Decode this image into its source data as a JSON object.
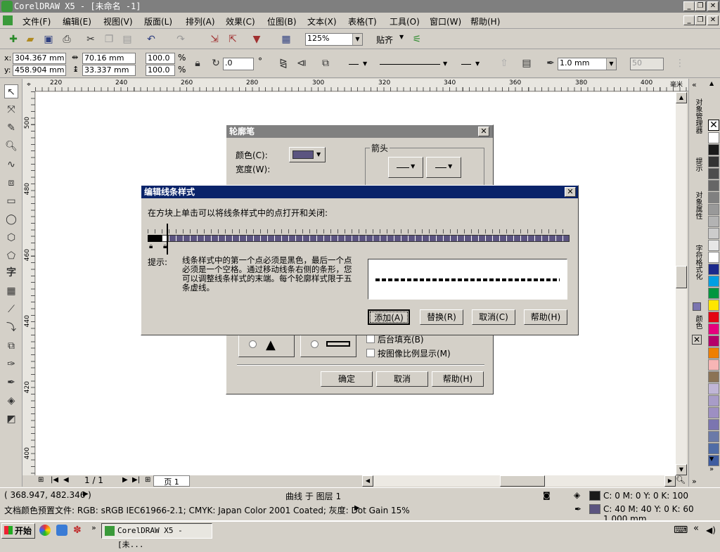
{
  "window": {
    "title": "CorelDRAW X5 - [未命名 -1]"
  },
  "menu": [
    "文件(F)",
    "编辑(E)",
    "视图(V)",
    "版面(L)",
    "排列(A)",
    "效果(C)",
    "位图(B)",
    "文本(X)",
    "表格(T)",
    "工具(O)",
    "窗口(W)",
    "帮助(H)"
  ],
  "toolbar": {
    "zoom": "125%",
    "snap_label": "贴齐"
  },
  "props": {
    "x": "304.367 mm",
    "y": "458.904 mm",
    "w": "70.16 mm",
    "h": "33.337 mm",
    "sx": "100.0",
    "sy": "100.0",
    "pct": "%",
    "angle": ".0",
    "deg": "°",
    "outline_width": "1.0 mm",
    "miter": "50"
  },
  "ruler": {
    "h_labels": [
      "220",
      "240",
      "260",
      "280",
      "300",
      "320",
      "340",
      "360",
      "380",
      "400"
    ],
    "unit": "毫米",
    "v_labels": [
      "500",
      "480",
      "460",
      "440",
      "420",
      "400"
    ]
  },
  "page_nav": {
    "count": "1 / 1",
    "tab": "页 1"
  },
  "dockers": [
    "对象管理器",
    "提示",
    "对象属性",
    "字符格式化",
    "颜色"
  ],
  "palette_colors": [
    "#ffffff",
    "#1a1a1a",
    "#333333",
    "#4d4d4d",
    "#666666",
    "#808080",
    "#999999",
    "#b3b3b3",
    "#cccccc",
    "#e6e6e6",
    "#ffffff",
    "#1c2a8c",
    "#009fe3",
    "#00963f",
    "#ffe600",
    "#e30613",
    "#e6007e",
    "#b5006a",
    "#ee7f00",
    "#f7b5b5",
    "#8b7355",
    "#c0b6d6",
    "#a89cc8",
    "#9d8fc2",
    "#7b75b0",
    "#6b7aa8",
    "#4f6ca6",
    "#3e5ca0"
  ],
  "status": {
    "coords": "( 368.947, 482.346 )",
    "object": "曲线 于 图层 1",
    "fill": "C: 0 M: 0 Y: 0 K: 100",
    "outline": "C: 40 M: 40 Y: 0 K: 60  1.000 mm",
    "profile": "文档颜色预置文件: RGB: sRGB IEC61966-2.1; CMYK: Japan Color 2001 Coated; 灰度: Dot Gain 15%"
  },
  "outline_dialog": {
    "title": "轮廓笔",
    "color_label": "颜色(C):",
    "width_label": "宽度(W):",
    "arrows_label": "箭头",
    "behind_fill": "后台填充(B)",
    "scale_with_image": "按图像比例显示(M)",
    "ok": "确定",
    "cancel": "取消",
    "help": "帮助(H)"
  },
  "edit_dialog": {
    "title": "编辑线条样式",
    "instruction": "在方块上单击可以将线条样式中的点打开和关闭:",
    "hint_label": "提示:",
    "hint_text": "线条样式中的第一个点必须是黑色，最后一个点必须是一个空格。通过移动线条右侧的条形，您可以调整线条样式的末端。每个轮廓样式限于五条虚线。",
    "add": "添加(A)",
    "replace": "替换(R)",
    "cancel": "取消(C)",
    "help": "帮助(H)"
  },
  "taskbar": {
    "start": "开始",
    "app": "CorelDRAW X5 - [未..."
  },
  "colors": {
    "dialog_title_active": "#0a246a",
    "dialog_title_inactive": "#808080",
    "outline_color": "#5b5480"
  }
}
